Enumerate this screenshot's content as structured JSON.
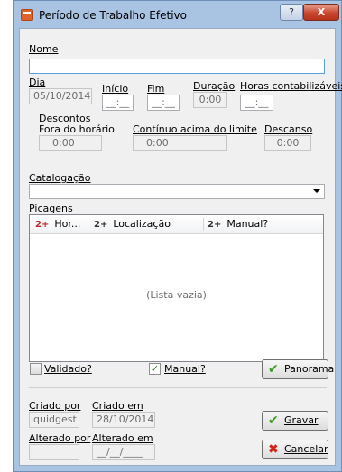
{
  "window": {
    "title": "Período de Trabalho Efetivo",
    "help_label": "?",
    "close_label": "X"
  },
  "nome": {
    "label": "Nome",
    "value": ""
  },
  "dia": {
    "label": "Dia",
    "value": "05/10/2014"
  },
  "inicio": {
    "label": "Início",
    "value": "__:__"
  },
  "fim": {
    "label": "Fim",
    "value": "__:__"
  },
  "duracao": {
    "label": "Duração",
    "value": "0:00"
  },
  "horas_contabilizaveis": {
    "label": "Horas contabilizáveis",
    "value": "__:__"
  },
  "descontos": {
    "label": "Descontos",
    "fora_horario": {
      "label": "Fora do horário",
      "value": "0:00"
    },
    "continuo": {
      "label": "Contínuo acima do limite",
      "value": "0:00"
    },
    "descanso": {
      "label": "Descanso",
      "value": "0:00"
    }
  },
  "catalogacao": {
    "label": "Catalogação",
    "value": ""
  },
  "picagens": {
    "label": "Picagens",
    "sort_icon_text": "2+",
    "columns": [
      "Hor...",
      "Localização",
      "Manual?"
    ],
    "empty_text": "(Lista vazia)"
  },
  "validado": {
    "label": "Validado?",
    "checked": false
  },
  "manual": {
    "label": "Manual?",
    "checked": true,
    "mark": "✓"
  },
  "buttons": {
    "panorama": "Panorama",
    "gravar": "Gravar",
    "cancelar": "Cancelar"
  },
  "criado_por": {
    "label": "Criado por",
    "value": "quidgest"
  },
  "criado_em": {
    "label": "Criado em",
    "value": "28/10/2014"
  },
  "alterado_por": {
    "label": "Alterado por",
    "value": ""
  },
  "alterado_em": {
    "label": "Alterado em",
    "value": "__/__/____"
  },
  "colors": {
    "accent": "#3a9b1f",
    "danger": "#d0251b",
    "frame": "#a9c3e3"
  }
}
